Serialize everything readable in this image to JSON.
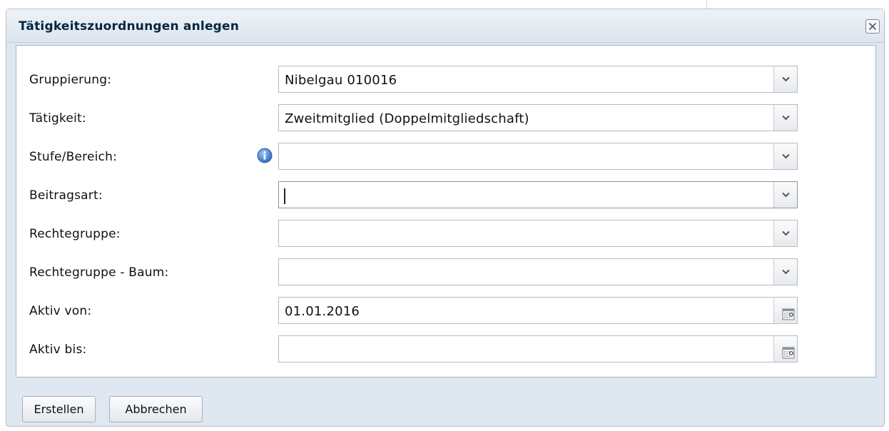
{
  "dialog": {
    "title": "Tätigkeitszuordnungen anlegen"
  },
  "form": {
    "fields": [
      {
        "label": "Gruppierung:",
        "value": "Nibelgau 010016",
        "type": "combo"
      },
      {
        "label": "Tätigkeit:",
        "value": "Zweitmitglied (Doppelmitgliedschaft)",
        "type": "combo"
      },
      {
        "label": "Stufe/Bereich:",
        "value": "",
        "type": "combo",
        "info_icon": "info-icon"
      },
      {
        "label": "Beitragsart:",
        "value": "",
        "type": "combo",
        "focused": true
      },
      {
        "label": "Rechtegruppe:",
        "value": "",
        "type": "combo"
      },
      {
        "label": "Rechtegruppe - Baum:",
        "value": "",
        "type": "combo"
      },
      {
        "label": "Aktiv von:",
        "value": "01.01.2016",
        "type": "date"
      },
      {
        "label": "Aktiv bis:",
        "value": "",
        "type": "date"
      }
    ]
  },
  "buttons": {
    "create_label": "Erstellen",
    "cancel_label": "Abbrechen"
  },
  "icons": {
    "close": "close-icon",
    "dropdown": "chevron-down-icon",
    "calendar": "calendar-icon",
    "info": "info-icon"
  },
  "colors": {
    "window_bg": "#dfe8f1",
    "title_text": "#04263f",
    "info_blue": "#3d7fcf"
  }
}
